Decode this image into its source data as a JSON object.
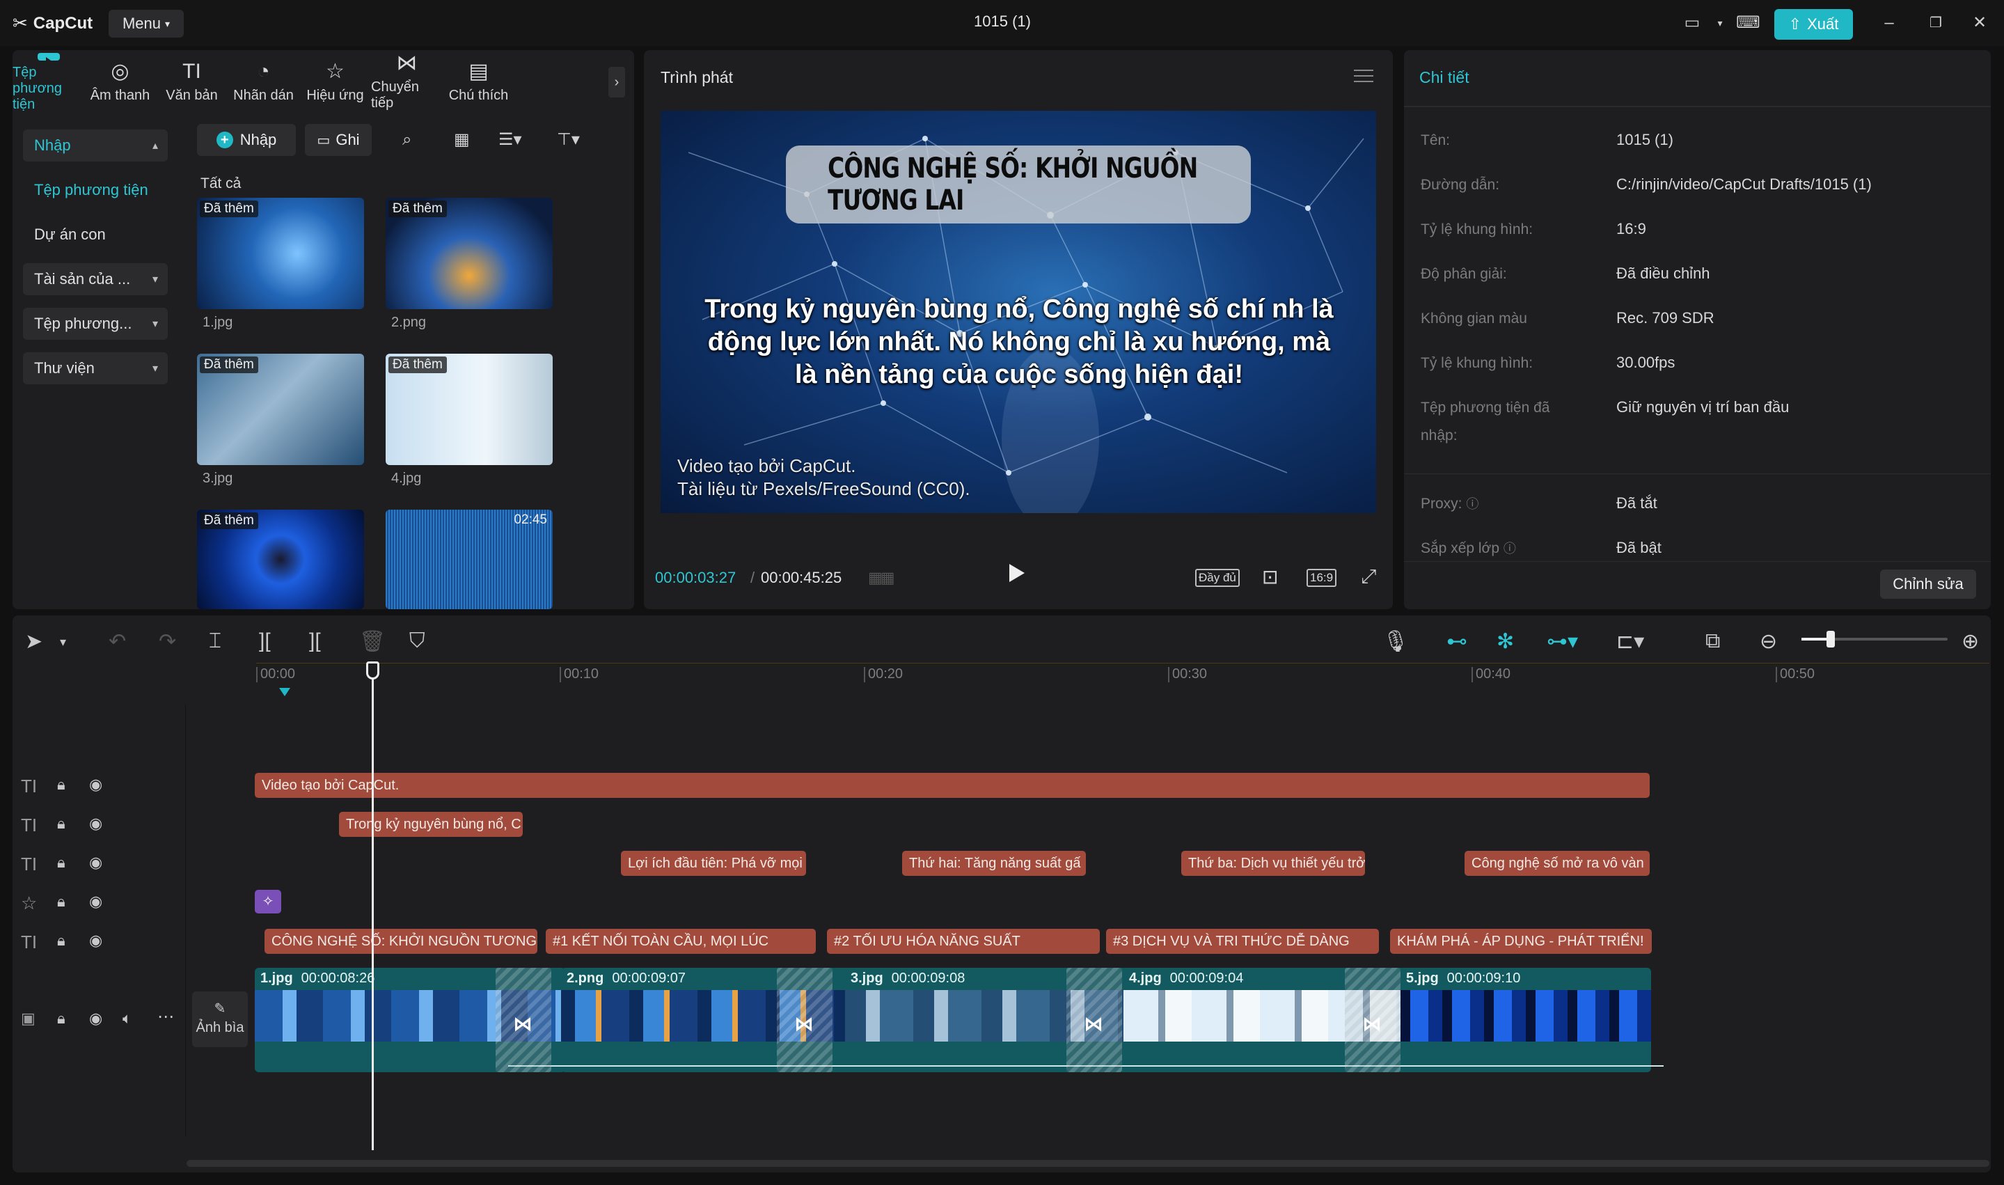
{
  "app": {
    "logo": "CapCut",
    "menu_label": "Menu",
    "window_title": "1015 (1)",
    "export_label": "Xuất"
  },
  "media": {
    "tabs": [
      {
        "label": "Tệp phương tiện",
        "icon": "media-icon",
        "active": true
      },
      {
        "label": "Âm thanh",
        "icon": "audio-icon"
      },
      {
        "label": "Văn bản",
        "icon": "text-icon"
      },
      {
        "label": "Nhãn dán",
        "icon": "sticker-icon"
      },
      {
        "label": "Hiệu ứng",
        "icon": "effects-icon"
      },
      {
        "label": "Chuyển tiếp",
        "icon": "transition-icon"
      },
      {
        "label": "Chú thích",
        "icon": "captions-icon"
      }
    ],
    "sidebar": {
      "import": "Nhập",
      "local_media": "Tệp phương tiện",
      "sub_projects": "Dự án con",
      "assets": "Tài sản của ...",
      "media_more": "Tệp phương...",
      "library": "Thư viện"
    },
    "import_btn": "Nhập",
    "record_btn": "Ghi",
    "all_label": "Tất cả",
    "added_tag": "Đã thêm",
    "items": [
      {
        "name": "1.jpg",
        "tag": "Đã thêm"
      },
      {
        "name": "2.png",
        "tag": "Đã thêm"
      },
      {
        "name": "3.jpg",
        "tag": "Đã thêm"
      },
      {
        "name": "4.jpg",
        "tag": "Đã thêm"
      },
      {
        "name": "",
        "tag": "Đã thêm"
      },
      {
        "name": "",
        "duration": "02:45"
      }
    ]
  },
  "player": {
    "title": "Trình phát",
    "video_title": "CÔNG NGHỆ SỐ: KHỞI NGUỒN TƯƠNG LAI",
    "video_text": "Trong kỷ nguyên bùng nổ, Công nghệ số chí nh là động lực lớn nhất. Nó không chỉ là xu hướng, mà là nền tảng của cuộc sống hiện đại!",
    "credit_line1": "Video tạo bởi CapCut.",
    "credit_line2": "Tài liệu từ Pexels/FreeSound (CC0).",
    "current_time": "00:00:03:27",
    "separator": "/",
    "total_time": "00:00:45:25",
    "full_label": "Đầy đủ",
    "ratio_label": "16:9"
  },
  "details": {
    "title": "Chi tiết",
    "rows": [
      {
        "label": "Tên:",
        "value": "1015 (1)"
      },
      {
        "label": "Đường dẫn:",
        "value": "C:/rinjin/video/CapCut Drafts/1015 (1)"
      },
      {
        "label": "Tỷ lệ khung hình:",
        "value": "16:9"
      },
      {
        "label": "Độ phân giải:",
        "value": "Đã điều chỉnh"
      },
      {
        "label": "Không gian màu",
        "value": "Rec. 709 SDR"
      },
      {
        "label": "Tỷ lệ khung hình:",
        "value": "30.00fps"
      },
      {
        "label": "Tệp phương tiện đã nhập:",
        "value": "Giữ nguyên vị trí ban đầu"
      },
      {
        "label": "Proxy:",
        "value": "Đã tắt"
      },
      {
        "label": "Sắp xếp lớp",
        "value": "Đã bật"
      }
    ],
    "edit_btn": "Chỉnh sửa"
  },
  "timeline": {
    "ticks": [
      "00:00",
      "00:10",
      "00:20",
      "00:30",
      "00:40",
      "00:50"
    ],
    "text_track_1": [
      "Video tạo bởi CapCut."
    ],
    "text_track_2": [
      "Trong kỷ nguyên bùng nổ, C"
    ],
    "text_track_3": [
      "Lợi ích đầu tiên: Phá vỡ mọi",
      "Thứ hai: Tăng năng suất gấ",
      "Thứ ba: Dịch vụ thiết yếu trở",
      "Công nghệ số mở ra vô vàn"
    ],
    "title_track": [
      "CÔNG NGHỆ SỐ: KHỞI NGUỒN TƯƠNG",
      "#1 KẾT NỐI TOÀN CẦU, MỌI LÚC",
      "#2 TỐI ƯU HÓA NĂNG SUẤT",
      "#3 DỊCH VỤ VÀ TRI THỨC DỄ DÀNG",
      "KHÁM PHÁ - ÁP DỤNG - PHÁT TRIỂN!"
    ],
    "video_clips": [
      {
        "name": "1.jpg",
        "duration": "00:00:08:26"
      },
      {
        "name": "2.png",
        "duration": "00:00:09:07"
      },
      {
        "name": "3.jpg",
        "duration": "00:00:09:08"
      },
      {
        "name": "4.jpg",
        "duration": "00:00:09:04"
      },
      {
        "name": "5.jpg",
        "duration": "00:00:09:10"
      }
    ],
    "cover_label": "Ảnh bìa"
  },
  "colors": {
    "accent": "#1fb8c4",
    "text_clip": "#a24b3d",
    "video_clip": "#135a60",
    "effect_clip": "#7b4fb8"
  }
}
